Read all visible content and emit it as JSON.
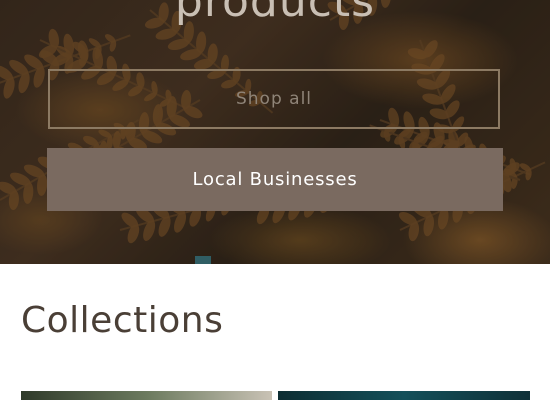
{
  "hero": {
    "title": "products",
    "shop_all_label": "Shop all",
    "local_businesses_label": "Local Businesses"
  },
  "collections": {
    "heading": "Collections"
  },
  "colors": {
    "outline_border": "#8c7a63",
    "solid_button_bg": "#7a6a60",
    "heading_text": "#4a3f36"
  }
}
